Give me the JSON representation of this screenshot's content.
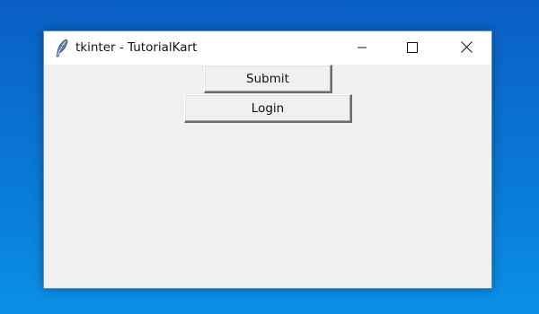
{
  "window": {
    "title": "tkinter - TutorialKart",
    "icon": "feather-icon",
    "controls": {
      "minimize_icon": "minimize-icon",
      "maximize_icon": "maximize-icon",
      "close_icon": "close-icon"
    }
  },
  "buttons": {
    "submit_label": "Submit",
    "login_label": "Login"
  },
  "colors": {
    "desktop_top": "#0a5fc4",
    "desktop_bottom": "#0a90e6",
    "window_background": "#f0f0f0",
    "titlebar_background": "#ffffff"
  }
}
